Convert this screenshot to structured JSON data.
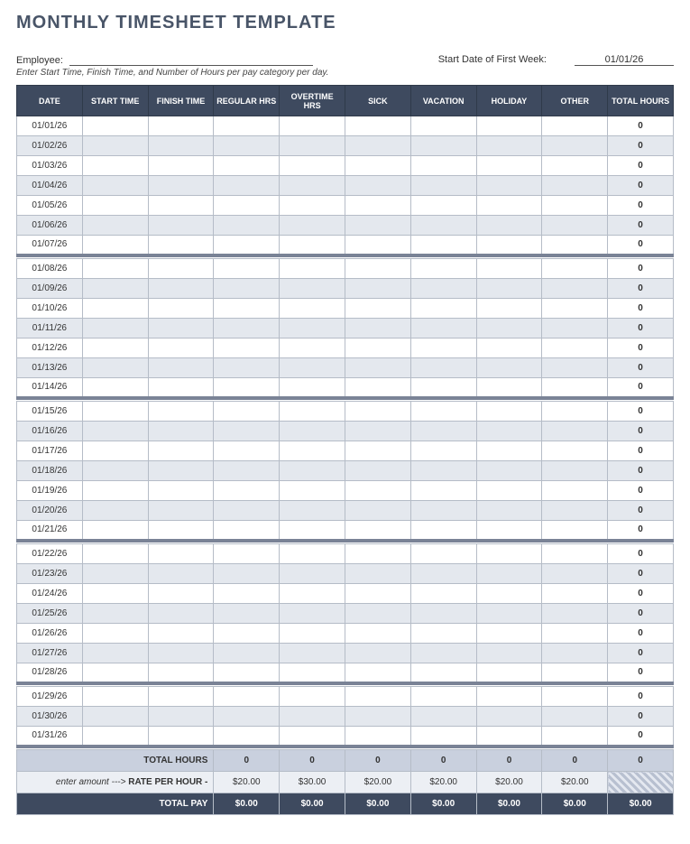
{
  "title": "MONTHLY TIMESHEET TEMPLATE",
  "meta": {
    "employee_label": "Employee:",
    "employee_value": "",
    "startdate_label": "Start Date of First Week:",
    "startdate_value": "01/01/26",
    "hint": "Enter Start Time, Finish Time, and Number of Hours per pay category per day."
  },
  "columns": [
    "DATE",
    "START TIME",
    "FINISH TIME",
    "REGULAR HRS",
    "OVERTIME HRS",
    "SICK",
    "VACATION",
    "HOLIDAY",
    "OTHER",
    "TOTAL HOURS"
  ],
  "weeks": [
    [
      {
        "date": "01/01/26",
        "total": "0"
      },
      {
        "date": "01/02/26",
        "total": "0"
      },
      {
        "date": "01/03/26",
        "total": "0"
      },
      {
        "date": "01/04/26",
        "total": "0"
      },
      {
        "date": "01/05/26",
        "total": "0"
      },
      {
        "date": "01/06/26",
        "total": "0"
      },
      {
        "date": "01/07/26",
        "total": "0"
      }
    ],
    [
      {
        "date": "01/08/26",
        "total": "0"
      },
      {
        "date": "01/09/26",
        "total": "0"
      },
      {
        "date": "01/10/26",
        "total": "0"
      },
      {
        "date": "01/11/26",
        "total": "0"
      },
      {
        "date": "01/12/26",
        "total": "0"
      },
      {
        "date": "01/13/26",
        "total": "0"
      },
      {
        "date": "01/14/26",
        "total": "0"
      }
    ],
    [
      {
        "date": "01/15/26",
        "total": "0"
      },
      {
        "date": "01/16/26",
        "total": "0"
      },
      {
        "date": "01/17/26",
        "total": "0"
      },
      {
        "date": "01/18/26",
        "total": "0"
      },
      {
        "date": "01/19/26",
        "total": "0"
      },
      {
        "date": "01/20/26",
        "total": "0"
      },
      {
        "date": "01/21/26",
        "total": "0"
      }
    ],
    [
      {
        "date": "01/22/26",
        "total": "0"
      },
      {
        "date": "01/23/26",
        "total": "0"
      },
      {
        "date": "01/24/26",
        "total": "0"
      },
      {
        "date": "01/25/26",
        "total": "0"
      },
      {
        "date": "01/26/26",
        "total": "0"
      },
      {
        "date": "01/27/26",
        "total": "0"
      },
      {
        "date": "01/28/26",
        "total": "0"
      }
    ],
    [
      {
        "date": "01/29/26",
        "total": "0"
      },
      {
        "date": "01/30/26",
        "total": "0"
      },
      {
        "date": "01/31/26",
        "total": "0"
      }
    ]
  ],
  "footer": {
    "total_hours_label": "TOTAL HOURS",
    "total_hours": [
      "0",
      "0",
      "0",
      "0",
      "0",
      "0",
      "0"
    ],
    "rate_prefix": "enter amount --->",
    "rate_label": "RATE PER HOUR -",
    "rates": [
      "$20.00",
      "$30.00",
      "$20.00",
      "$20.00",
      "$20.00",
      "$20.00"
    ],
    "total_pay_label": "TOTAL PAY",
    "total_pay": [
      "$0.00",
      "$0.00",
      "$0.00",
      "$0.00",
      "$0.00",
      "$0.00",
      "$0.00"
    ]
  }
}
